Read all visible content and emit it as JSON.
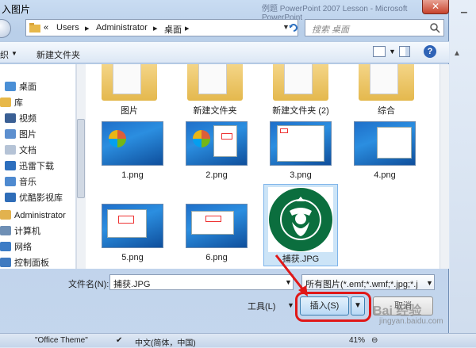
{
  "dialog": {
    "title": "入图片",
    "background_title": "例题 PowerPoint 2007 Lesson - Microsoft PowerPoint"
  },
  "address": {
    "prefix": "«",
    "crumbs": [
      "Users",
      "Administrator",
      "桌面"
    ],
    "search_placeholder": "搜索 桌面"
  },
  "toolbar": {
    "organize_label": "织",
    "new_folder_label": "新建文件夹"
  },
  "nav": {
    "items": [
      {
        "label": "桌面",
        "icon": "desktop-icon",
        "color": "#4a8fd6"
      },
      {
        "label": "库",
        "icon": "library-icon",
        "color": "#e7b84a"
      },
      {
        "label": "视频",
        "icon": "video-icon",
        "color": "#3a5f94"
      },
      {
        "label": "图片",
        "icon": "picture-icon",
        "color": "#5c8fcf"
      },
      {
        "label": "文档",
        "icon": "document-icon",
        "color": "#b5c3d6"
      },
      {
        "label": "迅雷下载",
        "icon": "download-icon",
        "color": "#2d6fbe"
      },
      {
        "label": "音乐",
        "icon": "music-icon",
        "color": "#4e8ad0"
      },
      {
        "label": "优酷影视库",
        "icon": "youku-icon",
        "color": "#2f6db8"
      },
      {
        "label": "Administrator",
        "icon": "user-icon",
        "color": "#e2b24e"
      },
      {
        "label": "计算机",
        "icon": "computer-icon",
        "color": "#6e8fb5"
      },
      {
        "label": "网络",
        "icon": "network-icon",
        "color": "#3c7cc6"
      },
      {
        "label": "控制面板",
        "icon": "control-panel-icon",
        "color": "#3f7ac0"
      }
    ]
  },
  "files": {
    "folders": [
      "图片",
      "新建文件夹",
      "新建文件夹 (2)",
      "综合"
    ],
    "images": [
      "1.png",
      "2.png",
      "3.png",
      "4.png",
      "5.png",
      "6.png"
    ],
    "selected": "捕获.JPG"
  },
  "bottom": {
    "filename_label": "文件名(N):",
    "filename_value": "捕获.JPG",
    "filetype_value": "所有图片(*.emf;*.wmf;*.jpg;*.j",
    "tools_label": "工具(L)",
    "insert_label": "插入(S)",
    "cancel_label": "取消"
  },
  "statusbar": {
    "theme": "\"Office Theme\"",
    "language": "中文(简体，中国)",
    "zoom": "41%"
  },
  "watermark": {
    "text": "Bai 经验",
    "url": "jingyan.baidu.com"
  },
  "colors": {
    "accent": "#3c7fb1",
    "highlight": "#e01818",
    "selection": "#cce4f7"
  }
}
